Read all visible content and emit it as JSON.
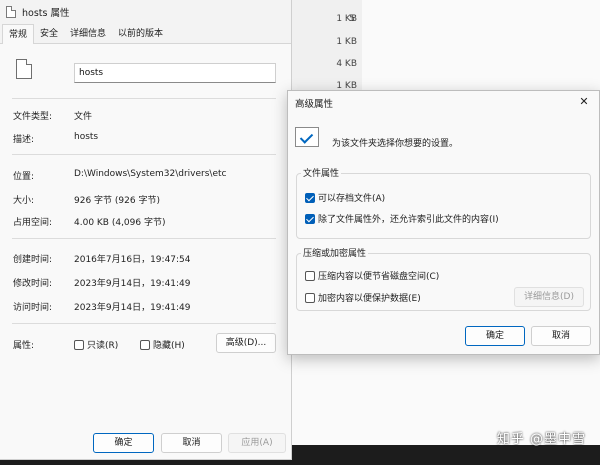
{
  "background": {
    "sizes": [
      "5",
      "1 KB",
      "1 KB",
      "4 KB",
      "1 KB"
    ],
    "watermark": "知乎 @墨中雪"
  },
  "props": {
    "title": "hosts 属性",
    "tabs": [
      "常规",
      "安全",
      "详细信息",
      "以前的版本"
    ],
    "filename": "hosts",
    "rows": {
      "type_label": "文件类型:",
      "type_value": "文件",
      "desc_label": "描述:",
      "desc_value": "hosts",
      "loc_label": "位置:",
      "loc_value": "D:\\Windows\\System32\\drivers\\etc",
      "size_label": "大小:",
      "size_value": "926 字节 (926 字节)",
      "disk_label": "占用空间:",
      "disk_value": "4.00 KB (4,096 字节)",
      "created_label": "创建时间:",
      "created_value": "2016年7月16日，19:47:54",
      "modified_label": "修改时间:",
      "modified_value": "2023年9月14日，19:41:49",
      "accessed_label": "访问时间:",
      "accessed_value": "2023年9月14日，19:41:49",
      "attr_label": "属性:"
    },
    "attributes": {
      "readonly": "只读(R)",
      "readonly_checked": false,
      "hidden": "隐藏(H)",
      "hidden_checked": false,
      "advanced_button": "高级(D)..."
    },
    "buttons": {
      "ok": "确定",
      "cancel": "取消",
      "apply": "应用(A)"
    }
  },
  "advanced": {
    "title": "高级属性",
    "info": "为该文件夹选择你想要的设置。",
    "file_attrs_title": "文件属性",
    "archive": "可以存档文件(A)",
    "archive_checked": true,
    "index": "除了文件属性外，还允许索引此文件的内容(I)",
    "index_checked": true,
    "compress_title": "压缩或加密属性",
    "compress": "压缩内容以便节省磁盘空间(C)",
    "compress_checked": false,
    "encrypt": "加密内容以便保护数据(E)",
    "encrypt_checked": false,
    "details_button": "详细信息(D)",
    "ok": "确定",
    "cancel": "取消"
  }
}
